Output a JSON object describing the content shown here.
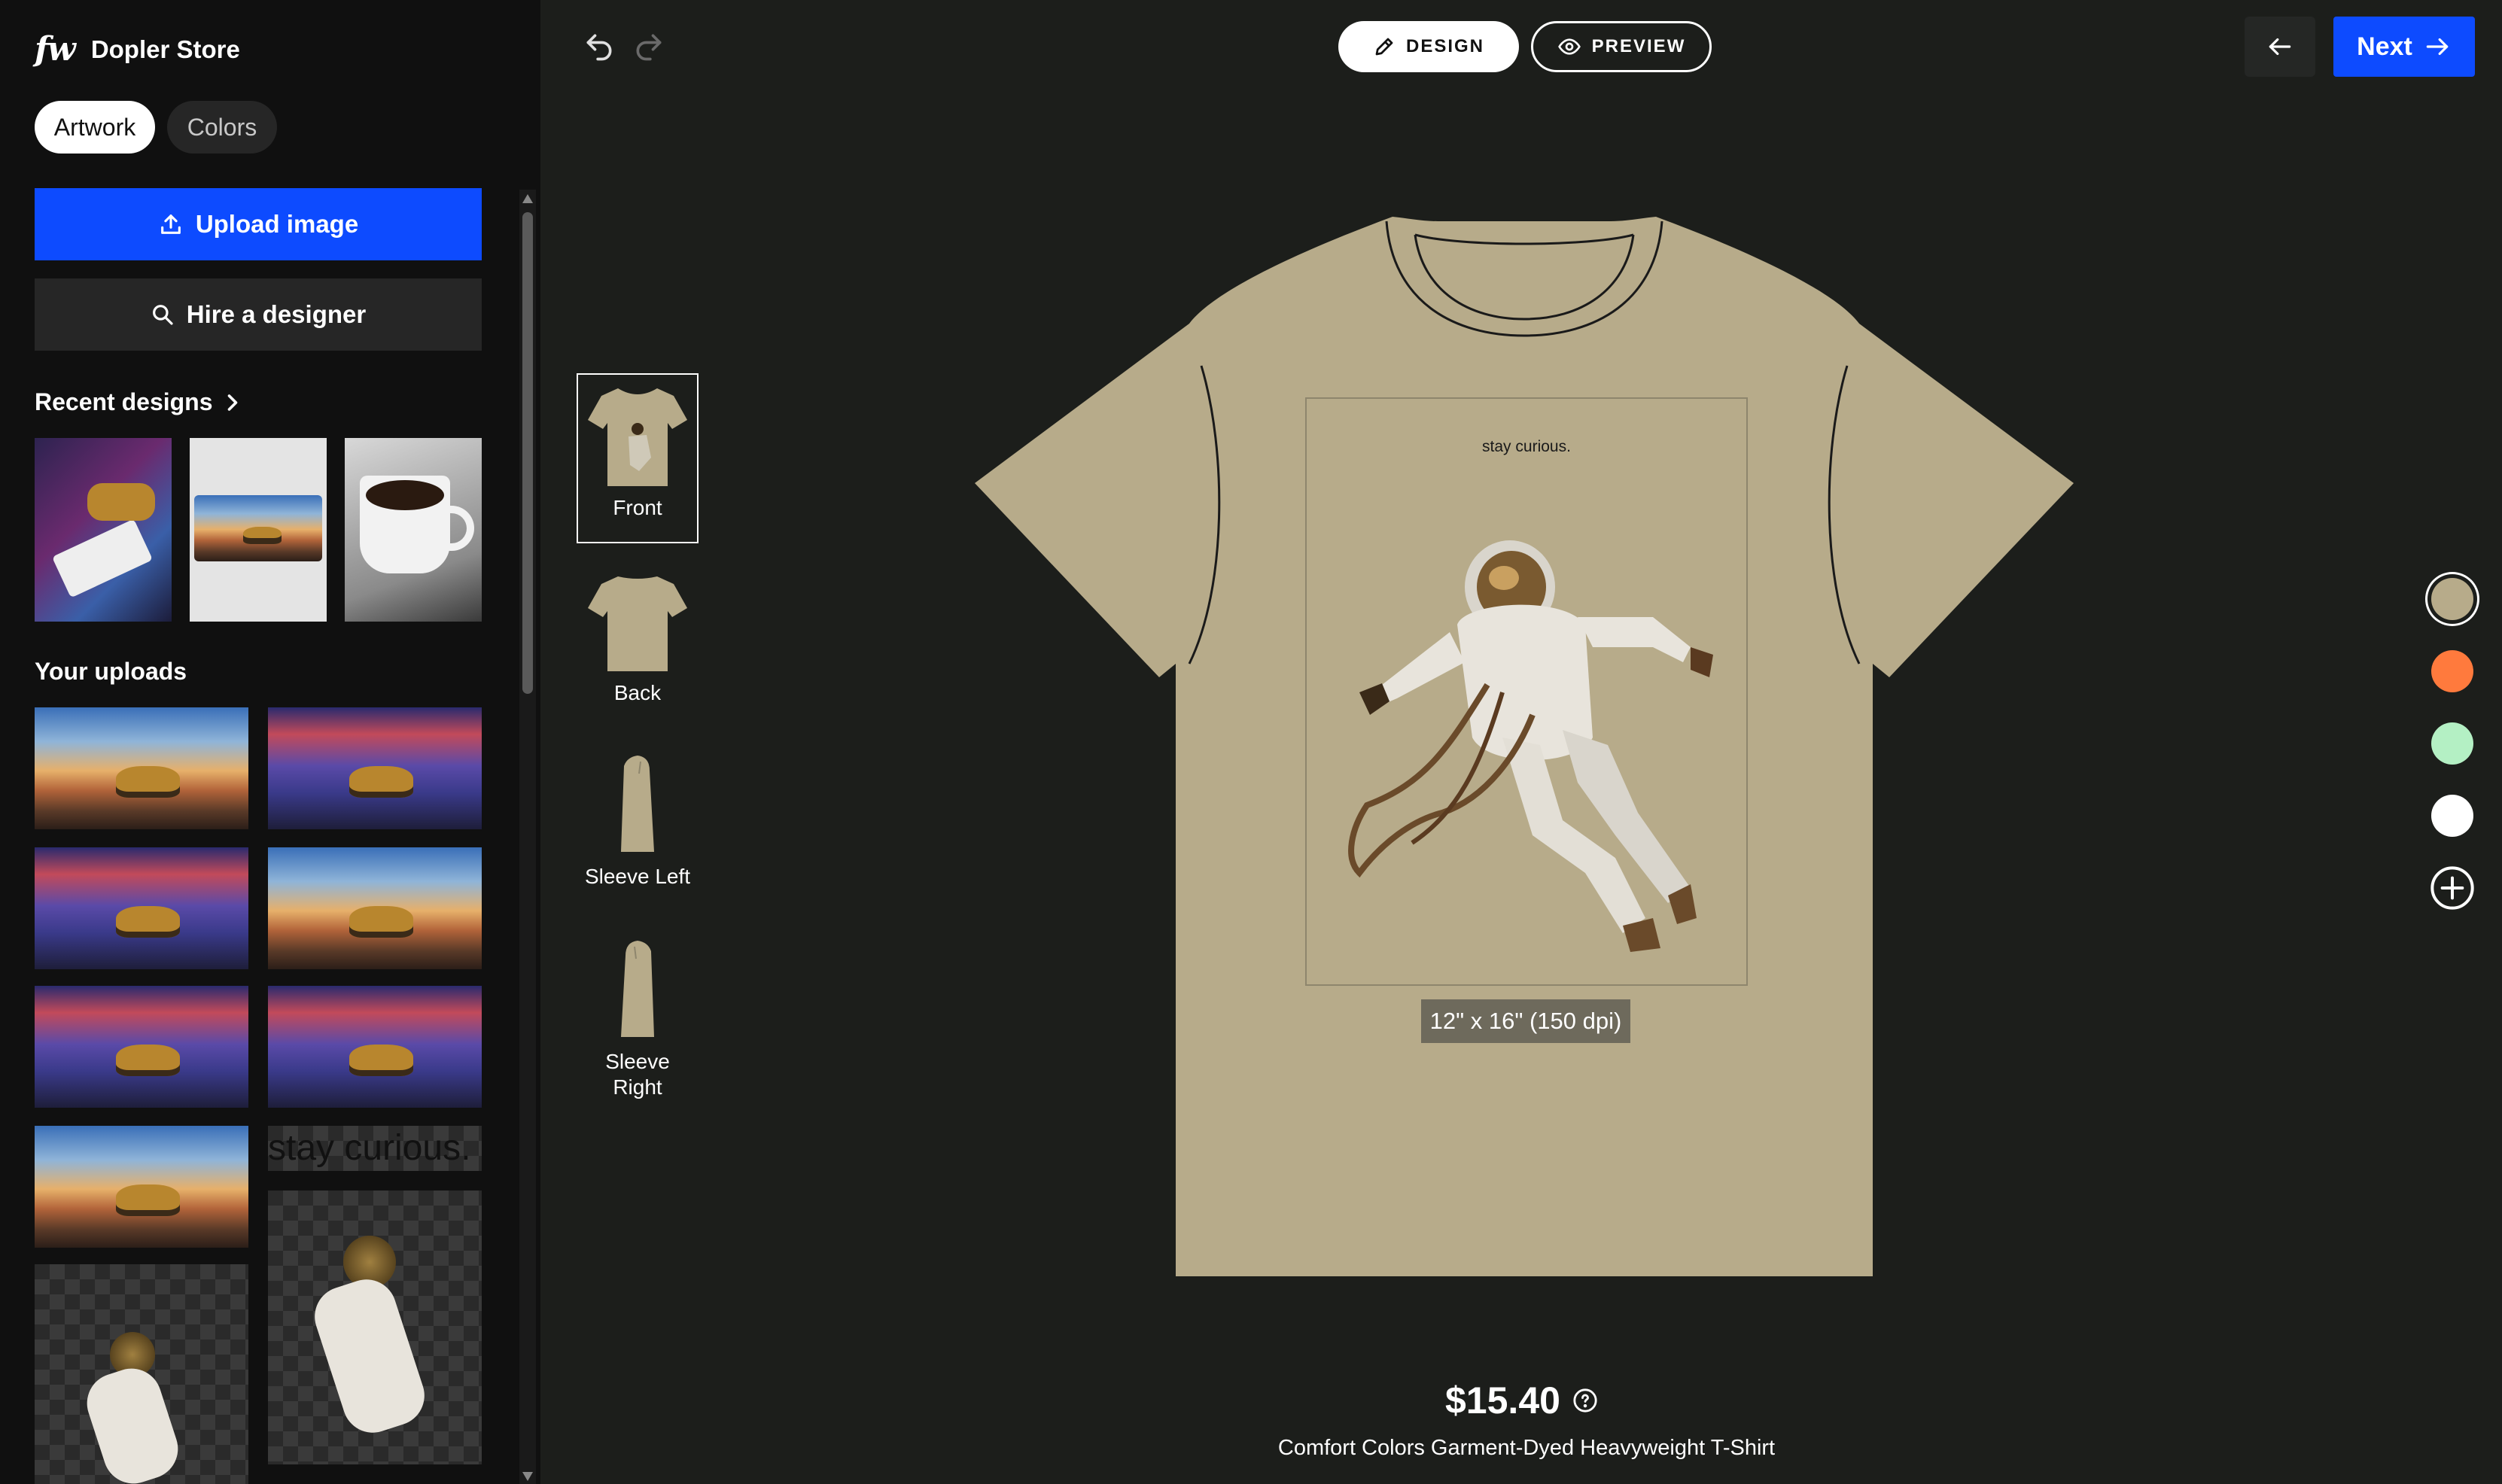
{
  "store": {
    "logo": "fw",
    "name": "Dopler Store"
  },
  "sidebar": {
    "tabs": [
      {
        "label": "Artwork",
        "active": true
      },
      {
        "label": "Colors",
        "active": false
      }
    ],
    "upload_label": "Upload image",
    "hire_label": "Hire a designer",
    "recent_title": "Recent designs",
    "uploads_title": "Your uploads",
    "uploads_text_thumb": "stay curious."
  },
  "toolbar": {
    "design_label": "DESIGN",
    "preview_label": "PREVIEW",
    "next_label": "Next"
  },
  "views": [
    {
      "label": "Front",
      "selected": true
    },
    {
      "label": "Back",
      "selected": false
    },
    {
      "label": "Sleeve Left",
      "selected": false
    },
    {
      "label": "Sleeve\nRight",
      "selected": false
    }
  ],
  "artwork": {
    "text": "stay curious.",
    "dimensions": "12\" x 16\" (150 dpi)"
  },
  "product": {
    "price": "$15.40",
    "name": "Comfort Colors Garment-Dyed Heavyweight T-Shirt"
  },
  "colors": {
    "shirt": "#b7ab8a",
    "accent": "#0d4bff",
    "swatches": [
      "#b7ab8a",
      "#ff7a3d",
      "#b4f0c4",
      "#ffffff"
    ]
  }
}
